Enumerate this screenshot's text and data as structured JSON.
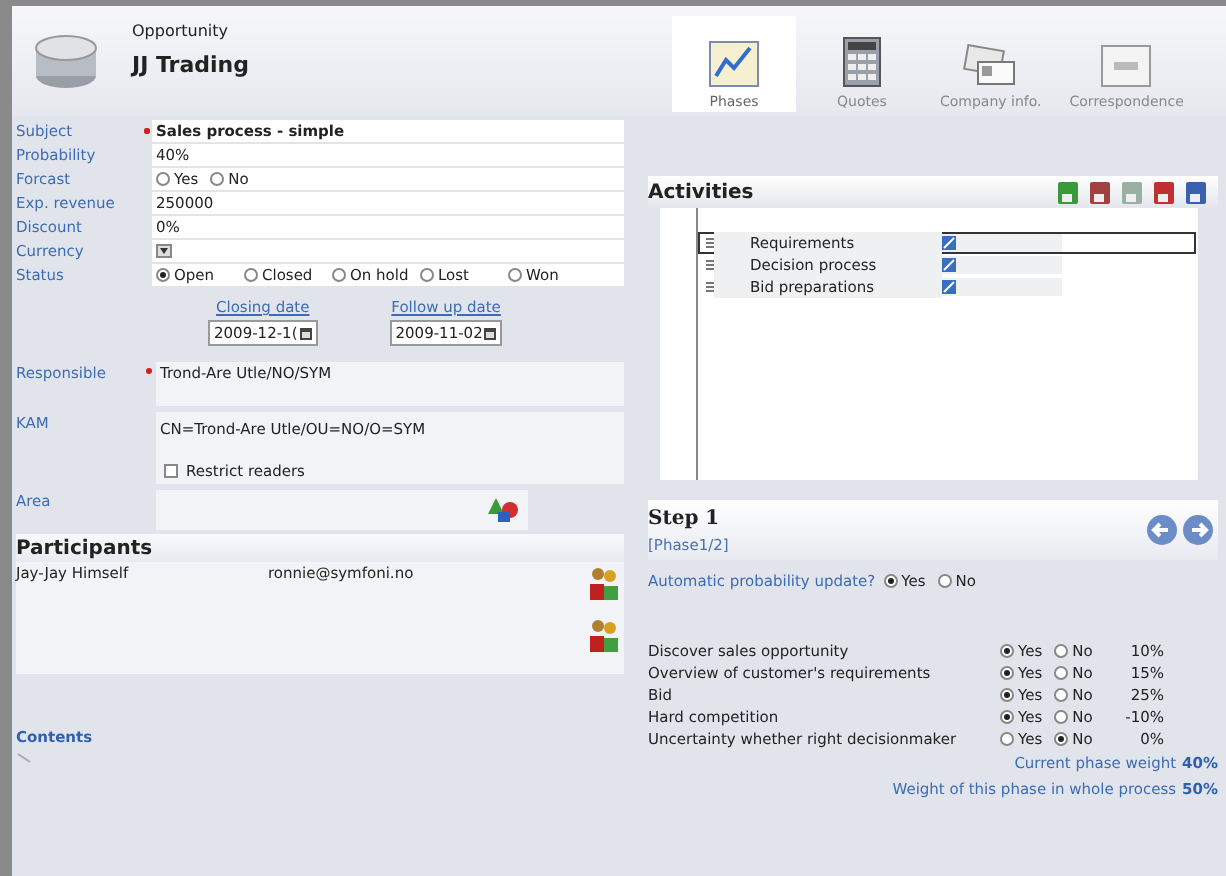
{
  "header": {
    "subtitle": "Opportunity",
    "title": "JJ Trading"
  },
  "tabs": [
    {
      "label": "Phases",
      "selected": true
    },
    {
      "label": "Quotes",
      "selected": false
    },
    {
      "label": "Company info.",
      "selected": false
    },
    {
      "label": "Correspondence",
      "selected": false
    }
  ],
  "fields": [
    {
      "kind": "text",
      "label": "Subject",
      "required": true,
      "value": "Sales process - simple"
    },
    {
      "kind": "text",
      "label": "Probability",
      "required": false,
      "value": "40%"
    },
    {
      "kind": "radio",
      "label": "Forcast",
      "options": [
        {
          "label": "Yes",
          "selected": false
        },
        {
          "label": "No",
          "selected": false
        }
      ]
    },
    {
      "kind": "text",
      "label": "Exp. revenue",
      "required": false,
      "value": "250000"
    },
    {
      "kind": "text",
      "label": "Discount",
      "required": false,
      "value": "0%"
    },
    {
      "kind": "select",
      "label": "Currency"
    },
    {
      "kind": "radio",
      "label": "Status",
      "options": [
        {
          "label": "Open",
          "selected": true
        },
        {
          "label": "Closed",
          "selected": false
        },
        {
          "label": "On hold",
          "selected": false
        },
        {
          "label": "Lost",
          "selected": false
        },
        {
          "label": "Won",
          "selected": false
        }
      ]
    }
  ],
  "dates": [
    {
      "label": "Closing date",
      "value": "2009-12-1("
    },
    {
      "label": "Follow up date",
      "value": "2009-11-02"
    }
  ],
  "responsible": {
    "label": "Responsible",
    "required": true,
    "value": "Trond-Are Utle/NO/SYM"
  },
  "kam": {
    "label": "KAM",
    "value": "CN=Trond-Are Utle/OU=NO/O=SYM"
  },
  "restrict_readers": {
    "label": "Restrict readers",
    "checked": false
  },
  "area": {
    "label": "Area"
  },
  "participants": {
    "title": "Participants",
    "rows": [
      {
        "name": "Jay-Jay Himself",
        "email": "ronnie@symfoni.no"
      }
    ]
  },
  "contents": {
    "label": "Contents"
  },
  "activities": {
    "title": "Activities",
    "items": [
      {
        "label": "Requirements",
        "selected": true
      },
      {
        "label": "Decision process",
        "selected": false
      },
      {
        "label": "Bid preparations",
        "selected": false
      }
    ]
  },
  "step": {
    "title": "Step 1",
    "subtitle": "[Phase1/2]"
  },
  "auto_update": {
    "label": "Automatic probability update?",
    "options": [
      {
        "label": "Yes",
        "selected": true
      },
      {
        "label": "No",
        "selected": false
      }
    ]
  },
  "criteria": [
    {
      "label": "Discover sales opportunity",
      "options": [
        {
          "label": "Yes",
          "selected": true
        },
        {
          "label": "No",
          "selected": false
        }
      ],
      "value": "10%"
    },
    {
      "label": "Overview of customer's requirements",
      "options": [
        {
          "label": "Yes",
          "selected": true
        },
        {
          "label": "No",
          "selected": false
        }
      ],
      "value": "15%"
    },
    {
      "label": "Bid",
      "options": [
        {
          "label": "Yes",
          "selected": true
        },
        {
          "label": "No",
          "selected": false
        }
      ],
      "value": "25%"
    },
    {
      "label": "Hard competition",
      "options": [
        {
          "label": "Yes",
          "selected": true
        },
        {
          "label": "No",
          "selected": false
        }
      ],
      "value": "-10%"
    },
    {
      "label": "Uncertainty whether right decisionmaker",
      "options": [
        {
          "label": "Yes",
          "selected": false
        },
        {
          "label": "No",
          "selected": true
        }
      ],
      "value": "0%"
    }
  ],
  "summary": [
    {
      "label": "Current phase weight",
      "value": "40%"
    },
    {
      "label": "Weight of this phase in whole process",
      "value": "50%"
    }
  ]
}
